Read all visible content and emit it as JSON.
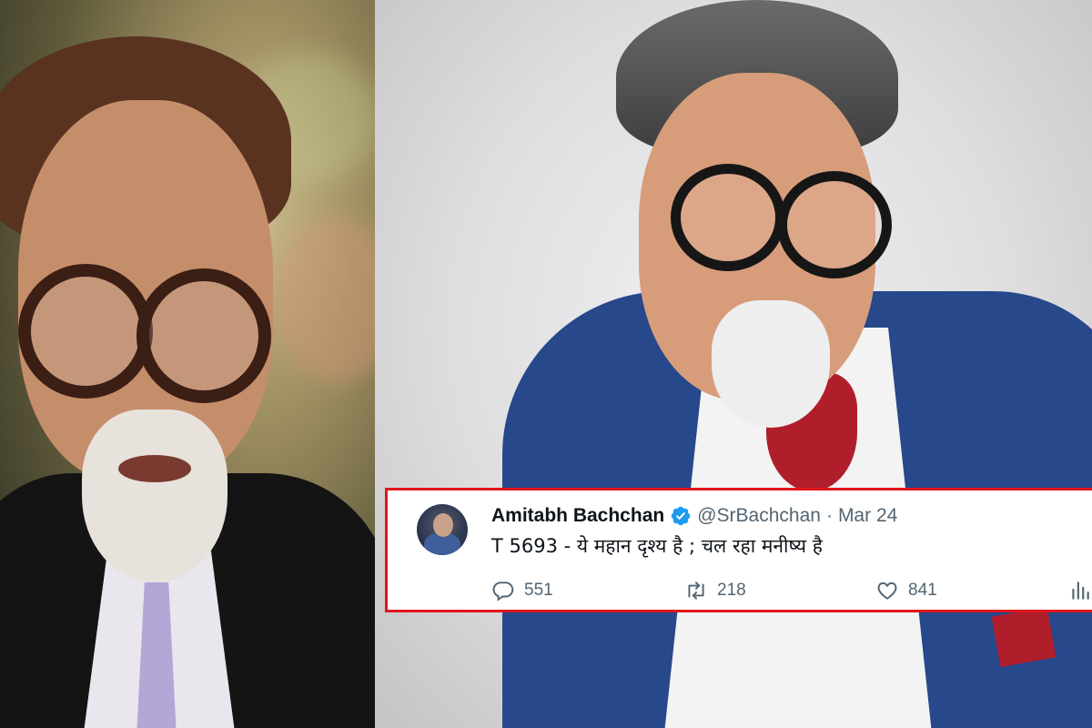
{
  "tweet": {
    "name": "Amitabh Bachchan",
    "handle": "@SrBachchan",
    "separator": "·",
    "date": "Mar 24",
    "text": "T 5693 - ये महान दृश्य है  ; चल रहा मनीष्य है",
    "replies": "551",
    "retweets": "218",
    "likes": "841"
  },
  "icons": {
    "verified": "verified-badge-icon",
    "reply": "reply-icon",
    "retweet": "retweet-icon",
    "like": "heart-icon",
    "views": "analytics-icon"
  },
  "colors": {
    "highlight_border": "#e0161c",
    "verified_blue": "#1d9bf0",
    "suit_blue": "#27488a"
  }
}
